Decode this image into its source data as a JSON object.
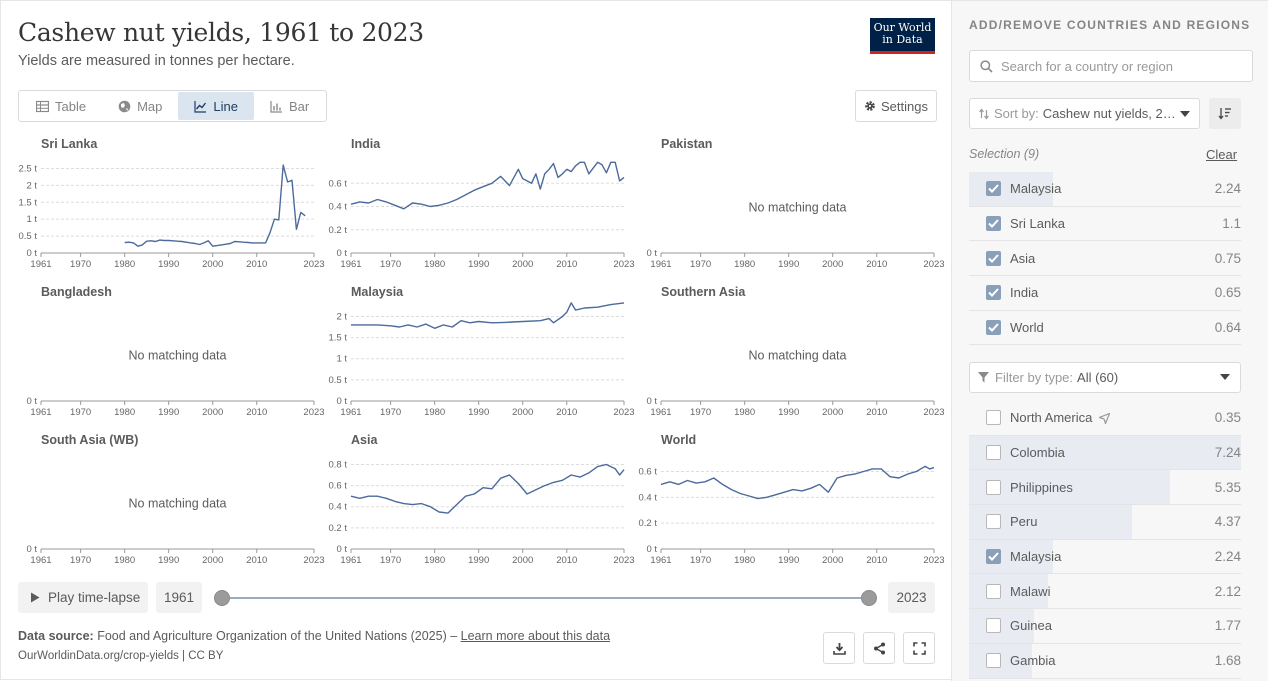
{
  "header": {
    "title": "Cashew nut yields, 1961 to 2023",
    "subtitle": "Yields are measured in tonnes per hectare.",
    "logo_line1": "Our World",
    "logo_line2": "in Data"
  },
  "tabs": [
    {
      "label": "Table",
      "icon": "table-icon",
      "active": false
    },
    {
      "label": "Map",
      "icon": "globe-icon",
      "active": false
    },
    {
      "label": "Line",
      "icon": "line-chart-icon",
      "active": true
    },
    {
      "label": "Bar",
      "icon": "bar-chart-icon",
      "active": false
    }
  ],
  "settings_label": "Settings",
  "timeline": {
    "play_label": "Play time-lapse",
    "start_year": "1961",
    "end_year": "2023"
  },
  "footer": {
    "source_label": "Data source:",
    "source_text": "Food and Agriculture Organization of the United Nations (2025) –",
    "learn_more": "Learn more about this data",
    "url": "OurWorldinData.org/crop-yields | CC BY"
  },
  "sidebar": {
    "heading": "ADD/REMOVE COUNTRIES AND REGIONS",
    "search_placeholder": "Search for a country or region",
    "sort_label": "Sort by:",
    "sort_value": "Cashew nut yields, 2…",
    "selection_label": "Selection (9)",
    "clear_label": "Clear",
    "selected": [
      {
        "name": "Malaysia",
        "value": "2.24",
        "checked": true,
        "bar": 0.31
      },
      {
        "name": "Sri Lanka",
        "value": "1.1",
        "checked": true,
        "bar": 0
      },
      {
        "name": "Asia",
        "value": "0.75",
        "checked": true,
        "bar": 0
      },
      {
        "name": "India",
        "value": "0.65",
        "checked": true,
        "bar": 0
      },
      {
        "name": "World",
        "value": "0.64",
        "checked": true,
        "bar": 0
      }
    ],
    "filter_label": "Filter by type:",
    "filter_value": "All (60)",
    "all": [
      {
        "name": "North America",
        "value": "0.35",
        "checked": false,
        "bar": 0,
        "locate": true
      },
      {
        "name": "Colombia",
        "value": "7.24",
        "checked": false,
        "bar": 1.0
      },
      {
        "name": "Philippines",
        "value": "5.35",
        "checked": false,
        "bar": 0.74
      },
      {
        "name": "Peru",
        "value": "4.37",
        "checked": false,
        "bar": 0.6
      },
      {
        "name": "Malaysia",
        "value": "2.24",
        "checked": true,
        "bar": 0.31
      },
      {
        "name": "Malawi",
        "value": "2.12",
        "checked": false,
        "bar": 0.29
      },
      {
        "name": "Guinea",
        "value": "1.77",
        "checked": false,
        "bar": 0.24
      },
      {
        "name": "Gambia",
        "value": "1.68",
        "checked": false,
        "bar": 0.23
      }
    ]
  },
  "chart_data": [
    {
      "type": "line",
      "title": "Sri Lanka",
      "ylim": [
        0,
        2.75
      ],
      "yticks": [
        0,
        0.5,
        1,
        1.5,
        2,
        2.5
      ],
      "yticklabels": [
        "0 t",
        "0.5 t",
        "1 t",
        "1.5 t",
        "2 t",
        "2.5 t"
      ],
      "xticklabels": [
        "1961",
        "1970",
        "1980",
        "1990",
        "2000",
        "2010",
        "2023"
      ],
      "x": [
        1980,
        1981,
        1982,
        1983,
        1984,
        1985,
        1986,
        1987,
        1988,
        1989,
        1990,
        1991,
        1992,
        1993,
        1994,
        1995,
        1996,
        1997,
        1998,
        1999,
        2000,
        2001,
        2002,
        2003,
        2004,
        2005,
        2006,
        2007,
        2008,
        2009,
        2010,
        2011,
        2012,
        2013,
        2014,
        2015,
        2016,
        2017,
        2018,
        2019,
        2020,
        2021,
        2022,
        2023
      ],
      "y": [
        0.31,
        0.32,
        0.3,
        0.2,
        0.24,
        0.35,
        0.36,
        0.34,
        0.38,
        0.37,
        0.37,
        0.36,
        0.35,
        0.34,
        0.32,
        0.3,
        0.28,
        0.25,
        0.3,
        0.36,
        0.2,
        0.22,
        0.24,
        0.26,
        0.28,
        0.34,
        0.33,
        0.32,
        0.31,
        0.3,
        0.3,
        0.3,
        0.3,
        0.6,
        1.0,
        0.98,
        2.6,
        2.1,
        2.15,
        0.7,
        1.2,
        1.1,
        null,
        null
      ]
    },
    {
      "type": "line",
      "title": "India",
      "ylim": [
        0,
        0.8
      ],
      "yticks": [
        0,
        0.2,
        0.4,
        0.6
      ],
      "yticklabels": [
        "0 t",
        "0.2 t",
        "0.4 t",
        "0.6 t"
      ],
      "xticklabels": [
        "1961",
        "1970",
        "1980",
        "1990",
        "2000",
        "2010",
        "2023"
      ],
      "x": [
        1961,
        1963,
        1965,
        1967,
        1969,
        1971,
        1973,
        1975,
        1977,
        1979,
        1981,
        1983,
        1985,
        1987,
        1989,
        1991,
        1993,
        1995,
        1997,
        1999,
        2000,
        2001,
        2002,
        2003,
        2004,
        2005,
        2006,
        2007,
        2008,
        2009,
        2010,
        2011,
        2012,
        2013,
        2014,
        2015,
        2016,
        2017,
        2018,
        2019,
        2020,
        2021,
        2022,
        2023
      ],
      "y": [
        0.42,
        0.44,
        0.43,
        0.46,
        0.44,
        0.41,
        0.38,
        0.43,
        0.42,
        0.4,
        0.41,
        0.43,
        0.46,
        0.5,
        0.54,
        0.57,
        0.6,
        0.66,
        0.58,
        0.72,
        0.64,
        0.62,
        0.6,
        0.68,
        0.55,
        0.68,
        0.72,
        0.77,
        0.65,
        0.68,
        0.72,
        0.7,
        0.75,
        0.78,
        0.78,
        0.68,
        0.73,
        0.78,
        0.76,
        0.69,
        0.78,
        0.78,
        0.62,
        0.65
      ]
    },
    {
      "type": "line",
      "title": "Pakistan",
      "ylim": [
        0,
        1
      ],
      "yticks": [
        0
      ],
      "yticklabels": [
        "0 t"
      ],
      "xticklabels": [
        "1961",
        "1970",
        "1980",
        "1990",
        "2000",
        "2010",
        "2023"
      ],
      "x": [],
      "y": [],
      "no_data": "No matching data"
    },
    {
      "type": "line",
      "title": "Bangladesh",
      "ylim": [
        0,
        1
      ],
      "yticks": [
        0
      ],
      "yticklabels": [
        "0 t"
      ],
      "xticklabels": [
        "1961",
        "1970",
        "1980",
        "1990",
        "2000",
        "2010",
        "2023"
      ],
      "x": [],
      "y": [],
      "no_data": "No matching data"
    },
    {
      "type": "line",
      "title": "Malaysia",
      "ylim": [
        0,
        2.2
      ],
      "yticks": [
        0,
        0.5,
        1,
        1.5,
        2
      ],
      "yticklabels": [
        "0 t",
        "0.5 t",
        "1 t",
        "1.5 t",
        "2 t"
      ],
      "xticklabels": [
        "1961",
        "1970",
        "1980",
        "1990",
        "2000",
        "2010",
        "2023"
      ],
      "x": [
        1961,
        1964,
        1967,
        1970,
        1972,
        1974,
        1976,
        1978,
        1980,
        1982,
        1984,
        1986,
        1988,
        1990,
        1993,
        1996,
        2000,
        2004,
        2006,
        2007,
        2009,
        2010,
        2011,
        2012,
        2014,
        2017,
        2020,
        2023
      ],
      "y": [
        1.8,
        1.8,
        1.8,
        1.78,
        1.75,
        1.8,
        1.75,
        1.82,
        1.72,
        1.8,
        1.75,
        1.9,
        1.85,
        1.88,
        1.85,
        1.86,
        1.88,
        1.9,
        1.95,
        1.85,
        2.0,
        2.1,
        2.32,
        2.15,
        2.2,
        2.22,
        2.28,
        2.32
      ]
    },
    {
      "type": "line",
      "title": "Southern Asia",
      "ylim": [
        0,
        1
      ],
      "yticks": [
        0
      ],
      "yticklabels": [
        "0 t"
      ],
      "xticklabels": [
        "1961",
        "1970",
        "1980",
        "1990",
        "2000",
        "2010",
        "2023"
      ],
      "x": [],
      "y": [],
      "no_data": "No matching data"
    },
    {
      "type": "line",
      "title": "South Asia (WB)",
      "ylim": [
        0,
        1
      ],
      "yticks": [
        0
      ],
      "yticklabels": [
        "0 t"
      ],
      "xticklabels": [
        "1961",
        "1970",
        "1980",
        "1990",
        "2000",
        "2010",
        "2023"
      ],
      "x": [],
      "y": [],
      "no_data": "No matching data"
    },
    {
      "type": "line",
      "title": "Asia",
      "ylim": [
        0,
        0.88
      ],
      "yticks": [
        0,
        0.2,
        0.4,
        0.6,
        0.8
      ],
      "yticklabels": [
        "0 t",
        "0.2 t",
        "0.4 t",
        "0.6 t",
        "0.8 t"
      ],
      "xticklabels": [
        "1961",
        "1970",
        "1980",
        "1990",
        "2000",
        "2010",
        "2023"
      ],
      "x": [
        1961,
        1963,
        1965,
        1967,
        1969,
        1971,
        1973,
        1975,
        1977,
        1979,
        1981,
        1983,
        1985,
        1987,
        1989,
        1991,
        1993,
        1995,
        1997,
        1999,
        2001,
        2003,
        2005,
        2007,
        2009,
        2011,
        2013,
        2015,
        2017,
        2019,
        2021,
        2022,
        2023
      ],
      "y": [
        0.5,
        0.48,
        0.5,
        0.5,
        0.48,
        0.45,
        0.43,
        0.42,
        0.43,
        0.4,
        0.35,
        0.34,
        0.42,
        0.5,
        0.52,
        0.58,
        0.57,
        0.67,
        0.7,
        0.62,
        0.52,
        0.56,
        0.6,
        0.63,
        0.65,
        0.7,
        0.68,
        0.72,
        0.78,
        0.8,
        0.76,
        0.7,
        0.75
      ]
    },
    {
      "type": "line",
      "title": "World",
      "ylim": [
        0,
        0.72
      ],
      "yticks": [
        0,
        0.2,
        0.4,
        0.6
      ],
      "yticklabels": [
        "0 t",
        "0.2 t",
        "0.4 t",
        "0.6 t"
      ],
      "xticklabels": [
        "1961",
        "1970",
        "1980",
        "1990",
        "2000",
        "2010",
        "2023"
      ],
      "x": [
        1961,
        1963,
        1965,
        1967,
        1969,
        1971,
        1973,
        1975,
        1977,
        1979,
        1981,
        1983,
        1985,
        1987,
        1989,
        1991,
        1993,
        1995,
        1997,
        1999,
        2001,
        2003,
        2005,
        2007,
        2009,
        2011,
        2013,
        2015,
        2017,
        2019,
        2021,
        2022,
        2023
      ],
      "y": [
        0.5,
        0.52,
        0.5,
        0.53,
        0.51,
        0.52,
        0.55,
        0.5,
        0.46,
        0.43,
        0.41,
        0.39,
        0.4,
        0.42,
        0.44,
        0.46,
        0.45,
        0.47,
        0.5,
        0.44,
        0.55,
        0.57,
        0.58,
        0.6,
        0.62,
        0.62,
        0.56,
        0.55,
        0.58,
        0.6,
        0.64,
        0.62,
        0.63
      ]
    }
  ],
  "colors": {
    "line": "#4c6a9c",
    "grid": "#dddddd",
    "axis": "#999999",
    "accent": "#1d3d63"
  }
}
